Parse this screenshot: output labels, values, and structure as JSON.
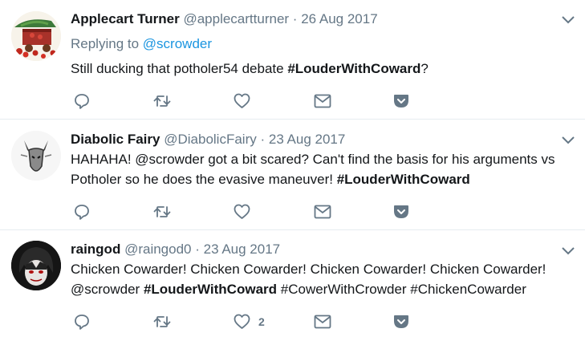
{
  "colors": {
    "icon": "#657786",
    "text": "#14171a",
    "muted": "#657786",
    "link": "#1b95e0",
    "divider": "#e6ecf0"
  },
  "tweets": [
    {
      "name": "Applecart Turner",
      "handle": "@applecartturner",
      "date": "26 Aug 2017",
      "replying_label": "Replying to",
      "replying_handle": "@scrowder",
      "text_parts": [
        "Still ducking that potholer54 debate ",
        "#LouderWithCoward",
        "?"
      ],
      "like_count": ""
    },
    {
      "name": "Diabolic Fairy",
      "handle": "@DiabolicFairy",
      "date": "23 Aug 2017",
      "text_line1": "HAHAHA! @scrowder got a bit scared? Can't find the basis for his arguments vs",
      "text_line2_parts": [
        "Potholer so he does the evasive maneuver! ",
        "#LouderWithCoward"
      ],
      "like_count": ""
    },
    {
      "name": "raingod",
      "handle": "@raingod0",
      "date": "23 Aug 2017",
      "text_line1": "Chicken Cowarder! Chicken Cowarder! Chicken Cowarder! Chicken Cowarder!",
      "text_line2_parts": [
        "@scrowder ",
        "#LouderWithCoward",
        " #CowerWithCrowder #ChickenCowarder"
      ],
      "like_count": "2"
    }
  ]
}
